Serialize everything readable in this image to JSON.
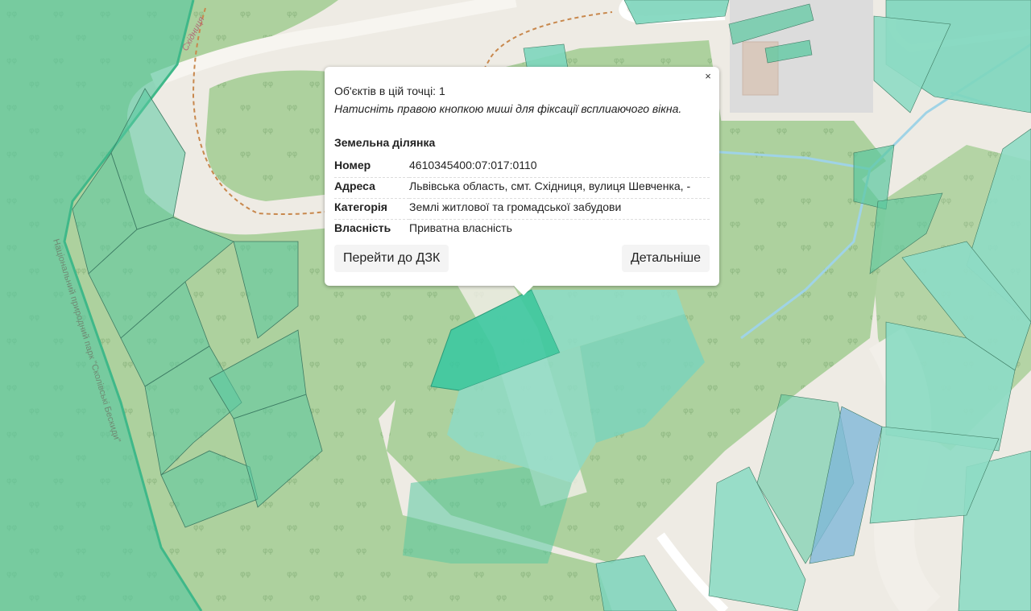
{
  "map": {
    "labels": {
      "park_label": "Національний природний парк \"Сколівські Бескиди\"",
      "trail_label": "Східниця"
    },
    "colors": {
      "background": "#eeebe4",
      "forest": "#add19e",
      "parcel": "#5ac8a0",
      "parcel_selected": "#3cc8a0",
      "parcel_blue": "#7fb8d8",
      "building": "#d9d0c9",
      "industrial": "#dcdcdc",
      "stream": "#9fd3e6",
      "trail": "#c8884d"
    }
  },
  "popup": {
    "count_text": "Об'єктів в цій точці: 1",
    "hint_text": "Натисніть правою кнопкою миші для фіксації всплиаючого вікна.",
    "close_symbol": "×",
    "section_title": "Земельна ділянка",
    "rows": [
      {
        "key": "Номер",
        "value": "4610345400:07:017:0110"
      },
      {
        "key": "Адреса",
        "value": "Львівська область, смт. Східниця, вулиця Шевченка, -"
      },
      {
        "key": "Категорія",
        "value": "Землі житлової та громадської забудови"
      },
      {
        "key": "Власність",
        "value": "Приватна власність"
      }
    ],
    "buttons": {
      "dzk": "Перейти до ДЗК",
      "details": "Детальніше"
    }
  }
}
